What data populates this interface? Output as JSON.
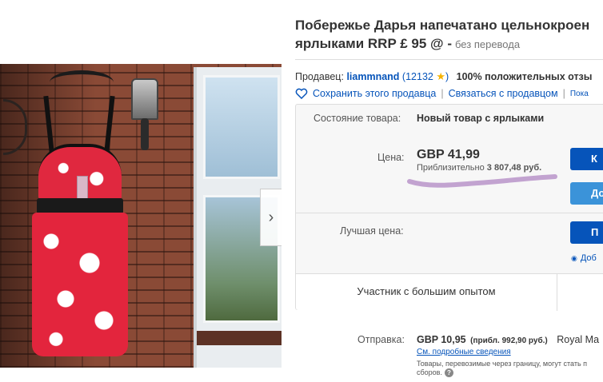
{
  "listing": {
    "title_line1": "Побережье Дарья напечатано цельнокроен",
    "title_line2": "ярлыками RRP £ 95 @ -",
    "translation_note": "без перевода"
  },
  "seller": {
    "label": "Продавец:",
    "name": "liammnand",
    "feedback_score": "(12132",
    "feedback_close": ")",
    "positive": "100% положительных отзы"
  },
  "actions": {
    "save_seller": "Сохранить этого продавца",
    "separator": "|",
    "contact_seller": "Связаться с продавцом",
    "more": "Пока"
  },
  "purchase": {
    "condition_label": "Состояние товара:",
    "condition_value": "Новый товар с ярлыками",
    "price_label": "Цена:",
    "price": "GBP 41,99",
    "approx_prefix": "Приблизительно",
    "approx_value": "3 807,48 руб.",
    "buy_now_label": "К",
    "add_cart_label": "До",
    "best_offer_label": "Лучшая цена:",
    "best_offer_button_label": "П",
    "watch_link": "Доб",
    "seller_level": "Участник с большим опытом"
  },
  "shipping": {
    "label": "Отправка:",
    "price": "GBP 10,95",
    "approx": "(прибл. 992,90 руб.)",
    "carrier": "Royal Ma",
    "details_link": "См. подробные сведения",
    "note": "Товары, перевозимые через границу, могут стать п сборов."
  },
  "colors": {
    "link": "#0654ba",
    "primary_button": "#0654ba",
    "secondary_button": "#3b93d9",
    "highlight_scribble": "#c2a3d0",
    "rating_star": "#f5b300"
  },
  "icons": {
    "save_seller": "heart-outline-icon",
    "rating": "star-icon",
    "watch": "eye-icon",
    "help": "question-icon",
    "next_image": "chevron-right-icon"
  }
}
